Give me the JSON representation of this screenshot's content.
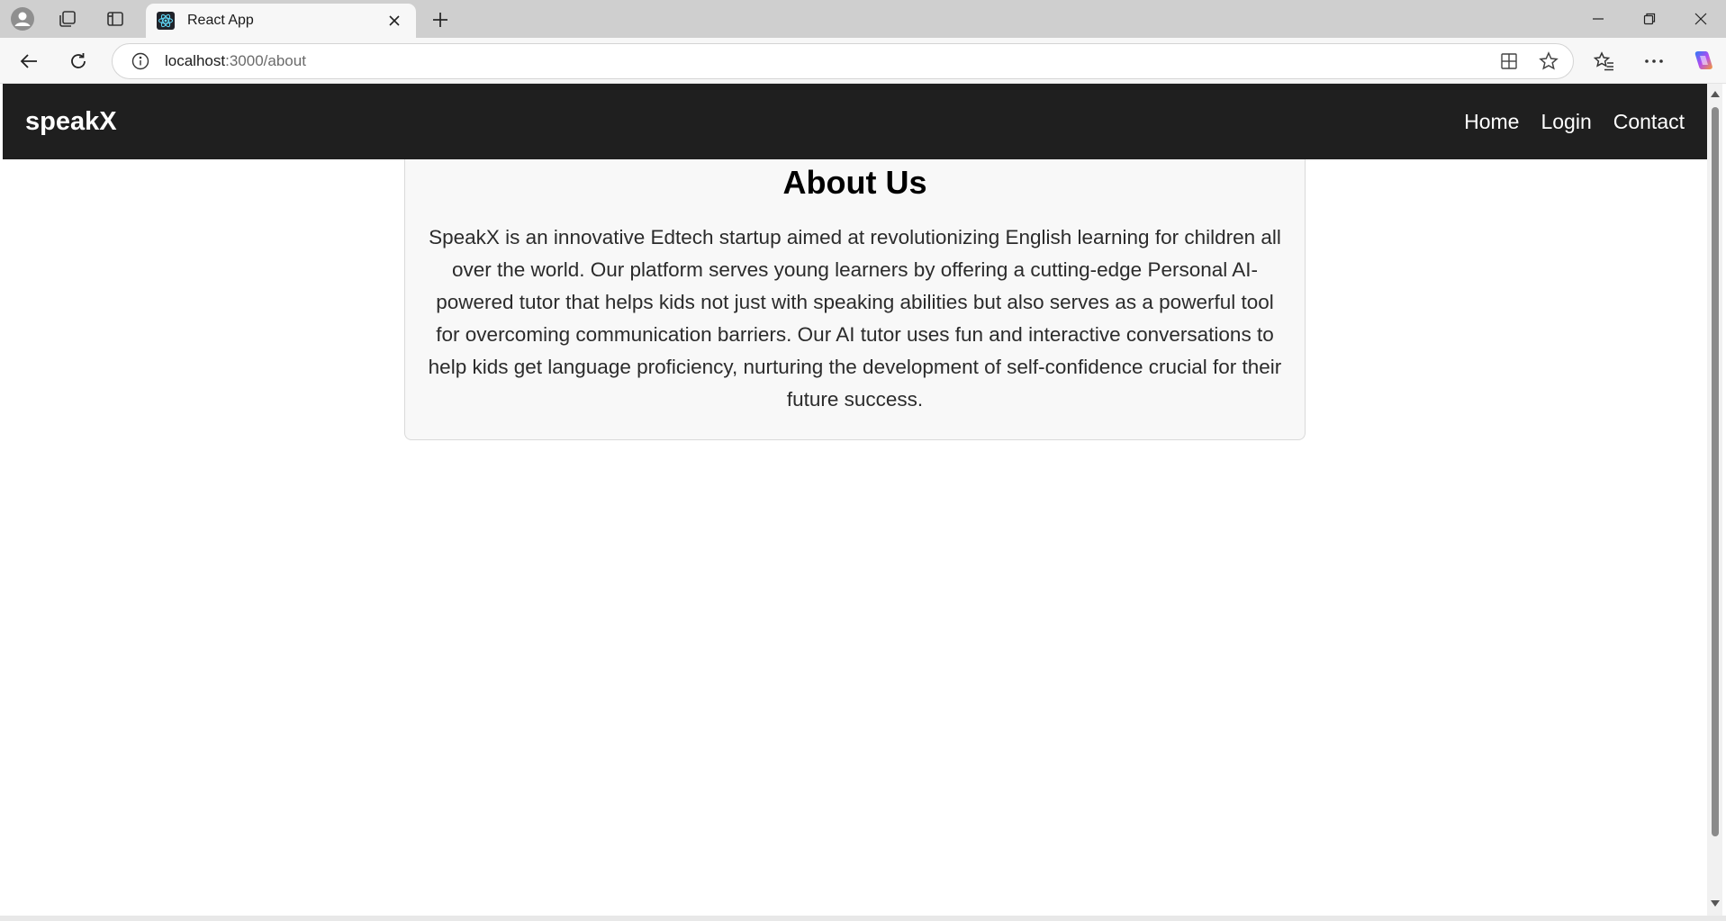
{
  "browser": {
    "tab": {
      "title": "React App"
    },
    "address": {
      "host": "localhost",
      "path": ":3000/about"
    }
  },
  "page": {
    "brand": "speakX",
    "nav": [
      {
        "label": "Home"
      },
      {
        "label": "Login"
      },
      {
        "label": "Contact"
      }
    ],
    "about": {
      "title": "About Us",
      "body": "SpeakX is an innovative Edtech startup aimed at revolutionizing English learning for children all over the world. Our platform serves young learners by offering a cutting-edge Personal AI-powered tutor that helps kids not just with speaking abilities but also serves as a powerful tool for overcoming communication barriers. Our AI tutor uses fun and interactive conversations to help kids get language proficiency, nurturing the development of self-confidence crucial for their future success."
    }
  },
  "colors": {
    "navbar": "#1f1f1f",
    "card": "#f8f8f8",
    "react": "#61dafb"
  }
}
